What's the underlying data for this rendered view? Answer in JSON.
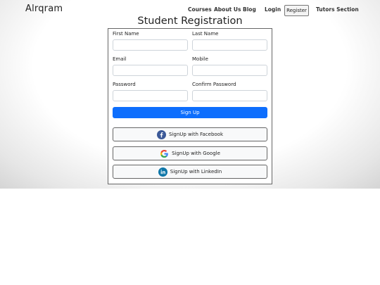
{
  "navbar": {
    "brand": "Alrqram",
    "links": [
      "Courses",
      "About Us",
      "Blog",
      "Login"
    ],
    "register": "Register",
    "tutors": "Tutors Section"
  },
  "page": {
    "title": "Student Registration"
  },
  "form": {
    "first_name_label": "First Name",
    "last_name_label": "Last Name",
    "email_label": "Email",
    "mobile_label": "Mobile",
    "password_label": "Password",
    "confirm_password_label": "Confirm Password",
    "signup_label": "Sign Up"
  },
  "social": {
    "facebook": "SignUp with Facebook",
    "google": "SignUp with Google",
    "linkedin": "SignUp with LinkedIn"
  },
  "icons": {
    "facebook": "facebook-icon",
    "google": "google-icon",
    "linkedin": "linkedin-icon"
  },
  "colors": {
    "primary": "#0d6efd",
    "facebook": "#3b5998",
    "linkedin": "#0e76a8"
  }
}
